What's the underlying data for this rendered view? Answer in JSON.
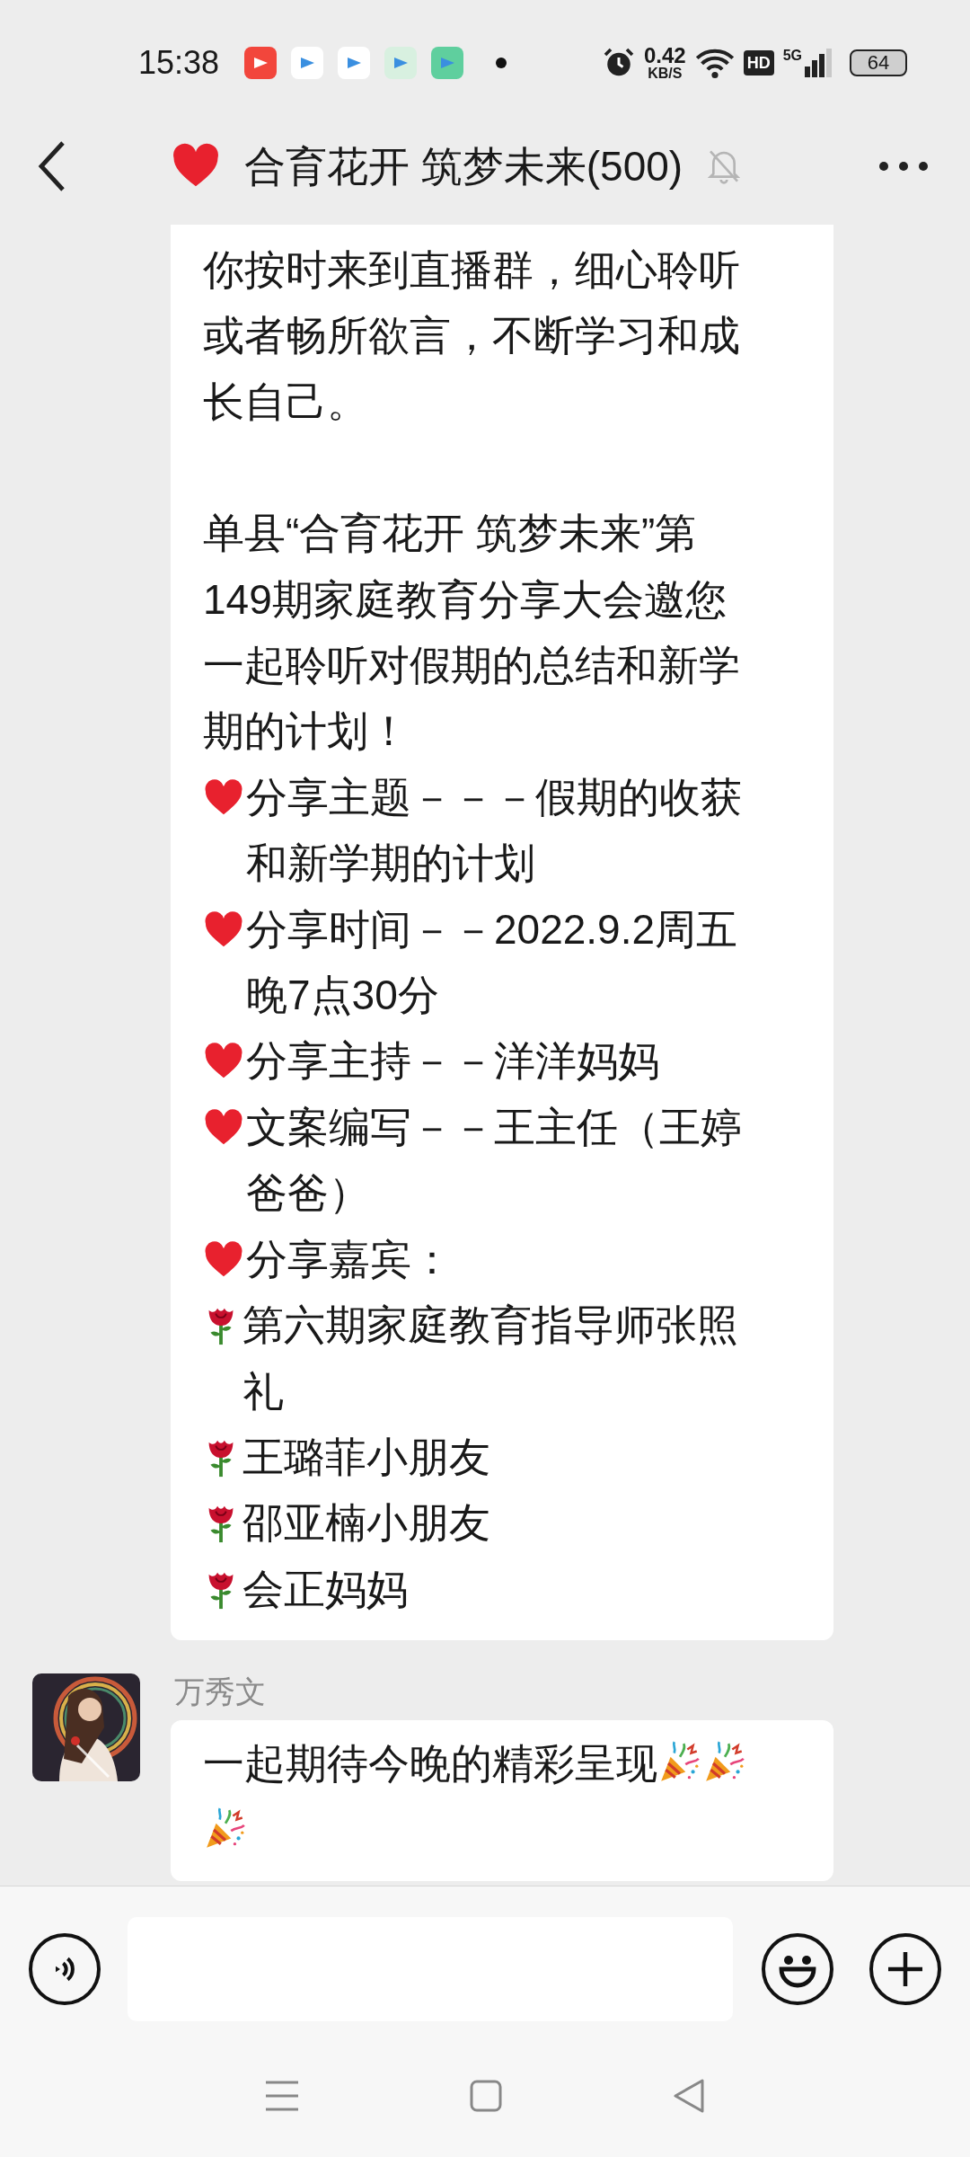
{
  "status_bar": {
    "time": "15:38",
    "notification_icons": [
      {
        "color": "#f2463c"
      },
      {
        "color": "#ffffff"
      },
      {
        "color": "#ffffff"
      },
      {
        "color": "#d8f0e0"
      },
      {
        "color": "#5fcf9e"
      }
    ],
    "net_speed": "0.42",
    "net_unit": "KB/S",
    "hd": "HD",
    "network": "5G",
    "battery": "64"
  },
  "header": {
    "title": "合育花开 筑梦未来(500)",
    "muted": true
  },
  "messages": [
    {
      "kind": "announcement",
      "lines": [
        {
          "kind": "text",
          "text": "你按时来到直播群，细心聆听或者畅所欲言，不断学习和成长自己。"
        },
        {
          "kind": "gap"
        },
        {
          "kind": "text",
          "text": "单县“合育花开 筑梦未来”第149期家庭教育分享大会邀您一起聆听对假期的总结和新学期的计划！"
        },
        {
          "kind": "heart",
          "text": "分享主题－－－假期的收获和新学期的计划"
        },
        {
          "kind": "heart",
          "text": "分享时间－－2022.9.2周五晚7点30分"
        },
        {
          "kind": "heart",
          "text": "分享主持－－洋洋妈妈"
        },
        {
          "kind": "heart",
          "text": "文案编写－－王主任（王婷爸爸）"
        },
        {
          "kind": "heart",
          "text": "分享嘉宾："
        },
        {
          "kind": "rose",
          "text": "第六期家庭教育指导师张照礼"
        },
        {
          "kind": "rose",
          "text": "王璐菲小朋友"
        },
        {
          "kind": "rose",
          "text": "邵亚楠小朋友"
        },
        {
          "kind": "rose",
          "text": "会正妈妈"
        }
      ]
    },
    {
      "kind": "member",
      "sender": "万秀文",
      "text": "一起期待今晚的精彩呈现",
      "emojis": [
        {
          "kind": "party_popper"
        },
        {
          "kind": "party_popper"
        },
        {
          "kind": "party_popper"
        }
      ]
    }
  ]
}
